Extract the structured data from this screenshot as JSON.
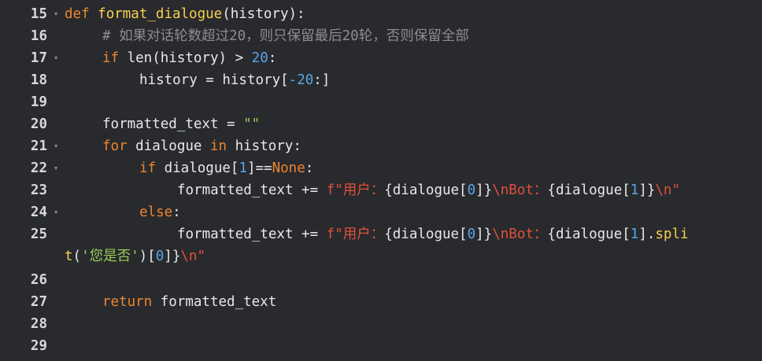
{
  "lines": [
    {
      "num": "15",
      "fold": true
    },
    {
      "num": "16",
      "fold": false
    },
    {
      "num": "17",
      "fold": true
    },
    {
      "num": "18",
      "fold": false
    },
    {
      "num": "19",
      "fold": false
    },
    {
      "num": "20",
      "fold": false
    },
    {
      "num": "21",
      "fold": true
    },
    {
      "num": "22",
      "fold": true
    },
    {
      "num": "23",
      "fold": false
    },
    {
      "num": "24",
      "fold": true
    },
    {
      "num": "25",
      "fold": false
    },
    {
      "num": "26",
      "fold": false
    },
    {
      "num": "27",
      "fold": false
    },
    {
      "num": "28",
      "fold": false
    },
    {
      "num": "29",
      "fold": false
    }
  ],
  "fold_glyph": "▾",
  "code": {
    "l15": {
      "kw": "def",
      "fn": "format_dialogue",
      "rest": "(history):"
    },
    "l16": {
      "comment": "# 如果对话轮数超过20，则只保留最后20轮，否则保留全部"
    },
    "l17": {
      "kw": "if",
      "a": " len(history) > ",
      "num": "20",
      "b": ":"
    },
    "l18": {
      "a": "history = history[",
      "num": "-20",
      "b": ":]"
    },
    "l20": {
      "a": "formatted_text = ",
      "str": "\"\""
    },
    "l21": {
      "kw": "for",
      "a": " dialogue ",
      "kw2": "in",
      "b": " history:"
    },
    "l22": {
      "kw": "if",
      "a": " dialogue[",
      "num": "1",
      "b": "]==",
      "none": "None",
      "c": ":"
    },
    "l23": {
      "a": "formatted_text += ",
      "f1": "f\"用户：",
      "b": "{dialogue[",
      "n0": "0",
      "c": "]}",
      "f2": "\\nBot：",
      "d": "{dialogue[",
      "n1": "1",
      "e": "]}",
      "f3": "\\n\""
    },
    "l24": {
      "kw": "else",
      "a": ":"
    },
    "l25": {
      "a": "formatted_text += ",
      "f1": "f\"用户：",
      "b": "{dialogue[",
      "n0": "0",
      "c": "]}",
      "f2": "\\nBot：",
      "d": "{dialogue[",
      "n1": "1",
      "e": "].",
      "m": "spli"
    },
    "l25w": {
      "m": "t",
      "a": "(",
      "s": "'您是否'",
      "b": ")[",
      "n0": "0",
      "c": "]}",
      "f3": "\\n\""
    },
    "l27": {
      "kw": "return",
      "a": " formatted_text"
    }
  },
  "colors": {
    "background": "#282a2e",
    "keyword": "#f0852d",
    "function": "#f7d04a",
    "number": "#5aa4e8",
    "comment": "#8d8d8d",
    "string": "#9acb55",
    "fstring": "#e0503a"
  }
}
